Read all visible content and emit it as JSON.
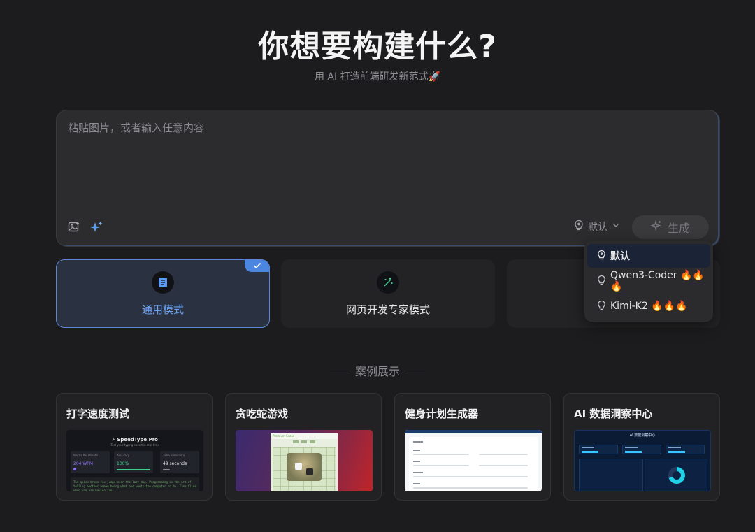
{
  "header": {
    "title": "你想要构建什么?",
    "subtitle": "用 AI 打造前端研发新范式🚀"
  },
  "prompt": {
    "placeholder": "粘贴图片，或者输入任意内容",
    "value": "",
    "model_label": "默认",
    "generate_label": "生成"
  },
  "modes": [
    {
      "label": "通用模式",
      "icon": "document-icon",
      "active": true
    },
    {
      "label": "网页开发专家模式",
      "icon": "magic-wand-icon",
      "active": false
    }
  ],
  "model_dropdown": {
    "items": [
      {
        "label": "默认",
        "selected": true
      },
      {
        "label": "Qwen3-Coder 🔥🔥🔥",
        "selected": false
      },
      {
        "label": "Kimi-K2 🔥🔥🔥",
        "selected": false
      }
    ]
  },
  "showcase": {
    "title": "案例展示",
    "cases": [
      {
        "title": "打字速度测试"
      },
      {
        "title": "贪吃蛇游戏"
      },
      {
        "title": "健身计划生成器"
      },
      {
        "title": "AI 数据洞察中心"
      }
    ],
    "speedtype": {
      "title": "SpeedType Pro",
      "subtitle": "Test your typing speed in real time",
      "stats": [
        {
          "label": "Words Per Minute",
          "value": "204 WPM",
          "color": "#8b6cf0"
        },
        {
          "label": "Accuracy",
          "value": "100%",
          "color": "#3ecf8e"
        },
        {
          "label": "Time Remaining",
          "value": "49 seconds",
          "color": "#e8e8ea"
        }
      ],
      "sample_text": "The quick brown fox jumps over the lazy dog. Programming is the art of telling another human being what one wants the computer to do. Time flies when you are having fun."
    },
    "snake": {
      "board_title": "Premium Snake"
    },
    "dashboard": {
      "title": "AI 数据洞察中心"
    }
  },
  "colors": {
    "background": "#1c1c1e",
    "accent": "#5b88d6",
    "active_text": "#6aa0ef"
  }
}
